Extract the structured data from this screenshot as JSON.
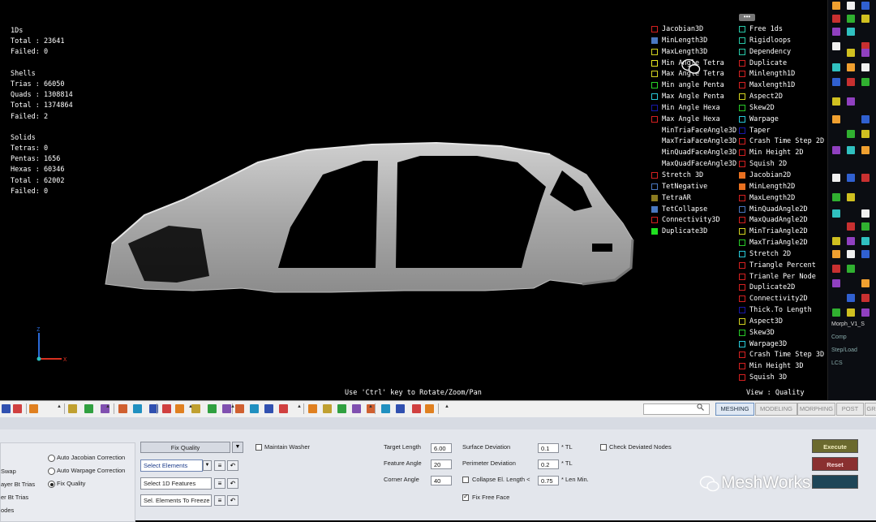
{
  "stats": {
    "lines": [
      "1Ds",
      "Total : 23641",
      "Failed: 0",
      "",
      "Shells",
      "Trias : 66050",
      "Quads : 1308814",
      "Total : 1374864",
      "Failed: 2",
      "",
      "Solids",
      "Tetras: 0",
      "Pentas: 1656",
      "Hexas : 60346",
      "Total : 62002",
      "Failed: 0"
    ]
  },
  "legend": {
    "col1": [
      {
        "label": "Jacobian3D",
        "color": "#d42020",
        "filled": false
      },
      {
        "label": "MinLength3D",
        "color": "#4a78c0",
        "filled": true
      },
      {
        "label": "MaxLength3D",
        "color": "#d4d420",
        "filled": false
      },
      {
        "label": "Min Angle Tetra",
        "color": "#e8e820",
        "filled": false
      },
      {
        "label": "Max Angle Tetra",
        "color": "#d4d420",
        "filled": false
      },
      {
        "label": "Min angle Penta",
        "color": "#28d428",
        "filled": false
      },
      {
        "label": "Max Angle Penta",
        "color": "#28c8d8",
        "filled": false
      },
      {
        "label": "Min Angle Hexa",
        "color": "#1818a8",
        "filled": false
      },
      {
        "label": "Max Angle Hexa",
        "color": "#d42020",
        "filled": false
      },
      {
        "label": "MinTriaFaceAngle3D",
        "color": "#000000",
        "filled": false
      },
      {
        "label": "MaxTriaFaceAngle3D",
        "color": "#000000",
        "filled": false
      },
      {
        "label": "MinQuadFaceAngle3D",
        "color": "#000000",
        "filled": false
      },
      {
        "label": "MaxQuadFaceAngle3D",
        "color": "#000000",
        "filled": false
      },
      {
        "label": "Stretch 3D",
        "color": "#d42020",
        "filled": false
      },
      {
        "label": "TetNegative",
        "color": "#4a78c0",
        "filled": false
      },
      {
        "label": "TetraAR",
        "color": "#8a7a20",
        "filled": true
      },
      {
        "label": "TetCollapse",
        "color": "#4a78c0",
        "filled": true
      },
      {
        "label": "Connectivity3D",
        "color": "#d42020",
        "filled": false
      },
      {
        "label": "Duplicate3D",
        "color": "#20e020",
        "filled": true
      }
    ],
    "col2": [
      {
        "label": "Free 1ds",
        "color": "#28c8a8",
        "filled": false
      },
      {
        "label": "Rigidloops",
        "color": "#28c8a8",
        "filled": false
      },
      {
        "label": "Dependency",
        "color": "#28c8a8",
        "filled": false
      },
      {
        "label": "Duplicate",
        "color": "#d42020",
        "filled": false
      },
      {
        "label": "Minlength1D",
        "color": "#d42020",
        "filled": false
      },
      {
        "label": "Maxlength1D",
        "color": "#d42020",
        "filled": false
      },
      {
        "label": "Aspect2D",
        "color": "#d4d420",
        "filled": false
      },
      {
        "label": "Skew2D",
        "color": "#28c828",
        "filled": false
      },
      {
        "label": "Warpage",
        "color": "#28c8d8",
        "filled": false
      },
      {
        "label": "Taper",
        "color": "#1818a8",
        "filled": false
      },
      {
        "label": "Crash Time Step 2D",
        "color": "#d42020",
        "filled": false
      },
      {
        "label": "Min Height 2D",
        "color": "#d42020",
        "filled": false
      },
      {
        "label": "Squish 2D",
        "color": "#d42020",
        "filled": false
      },
      {
        "label": "Jacobian2D",
        "color": "#e87020",
        "filled": true
      },
      {
        "label": "MinLength2D",
        "color": "#e87020",
        "filled": true
      },
      {
        "label": "MaxLength2D",
        "color": "#d42020",
        "filled": false
      },
      {
        "label": "MinQuadAngle2D",
        "color": "#4a78c0",
        "filled": false
      },
      {
        "label": "MaxQuadAngle2D",
        "color": "#d42020",
        "filled": false
      },
      {
        "label": "MinTriaAngle2D",
        "color": "#d4d420",
        "filled": false
      },
      {
        "label": "MaxTriaAngle2D",
        "color": "#28c828",
        "filled": false
      },
      {
        "label": "Stretch 2D",
        "color": "#28c8d8",
        "filled": false
      },
      {
        "label": "Triangle Percent",
        "color": "#d42020",
        "filled": false
      },
      {
        "label": "Trianle Per Node",
        "color": "#d42020",
        "filled": false
      },
      {
        "label": "Duplicate2D",
        "color": "#d42020",
        "filled": false
      },
      {
        "label": "Connectivity2D",
        "color": "#d42020",
        "filled": false
      },
      {
        "label": "Thick.To Length",
        "color": "#1818a8",
        "filled": false
      },
      {
        "label": "Aspect3D",
        "color": "#d4d420",
        "filled": false
      },
      {
        "label": "Skew3D",
        "color": "#28c828",
        "filled": false
      },
      {
        "label": "Warpage3D",
        "color": "#28c8d8",
        "filled": false
      },
      {
        "label": "Crash Time Step 3D",
        "color": "#d42020",
        "filled": false
      },
      {
        "label": "Min Height 3D",
        "color": "#d42020",
        "filled": false
      },
      {
        "label": "Squish 3D",
        "color": "#d42020",
        "filled": false
      }
    ]
  },
  "viewport": {
    "more_label": "•••",
    "hint": "Use 'Ctrl' key to Rotate/Zoom/Pan",
    "view_label": "View : Quality",
    "axis": {
      "z": "Z",
      "x": "X"
    }
  },
  "right_palette": {
    "entries": [
      "Morph_V1_S",
      "Comp",
      "Step/Load",
      "LCS"
    ]
  },
  "toolbar": {
    "tabs": [
      "MESHING",
      "MODELING",
      "MORPHING",
      "POST",
      "GR"
    ],
    "active_tab": "MESHING"
  },
  "panel": {
    "left_items": [
      "Swap",
      "ayer Bt Trias",
      "er Bt Trias",
      "odes"
    ],
    "radios": [
      {
        "label": "Auto Jacobian Correction",
        "checked": false
      },
      {
        "label": "Auto Warpage Correction",
        "checked": false
      },
      {
        "label": "Fix Quality",
        "checked": true
      }
    ],
    "mode_dropdown": "Fix Quality",
    "maintain_washer": {
      "label": "Maintain Washer",
      "checked": false
    },
    "select_elements": "Select Elements",
    "select_1d": "Select 1D Features",
    "sel_freeze": "Sel. Elements To Freeze",
    "target_length": {
      "label": "Target Length",
      "value": "6.00"
    },
    "feature_angle": {
      "label": "Feature Angle",
      "value": "20"
    },
    "corner_angle": {
      "label": "Corner Angle",
      "value": "40"
    },
    "surface_dev": {
      "label": "Surface Deviation",
      "value": "0.1",
      "unit": "* TL"
    },
    "perimeter_dev": {
      "label": "Perimeter Deviation",
      "value": "0.2",
      "unit": "* TL"
    },
    "collapse": {
      "label": "Collapse El. Length <",
      "value": "0.75",
      "unit": "* Len Min.",
      "checked": false
    },
    "fix_free_face": {
      "label": "Fix Free Face",
      "checked": true
    },
    "check_deviated": {
      "label": "Check Deviated Nodes",
      "checked": false
    },
    "buttons": {
      "execute": "Execute",
      "reset": "Reset"
    }
  },
  "watermark": "MeshWorks"
}
